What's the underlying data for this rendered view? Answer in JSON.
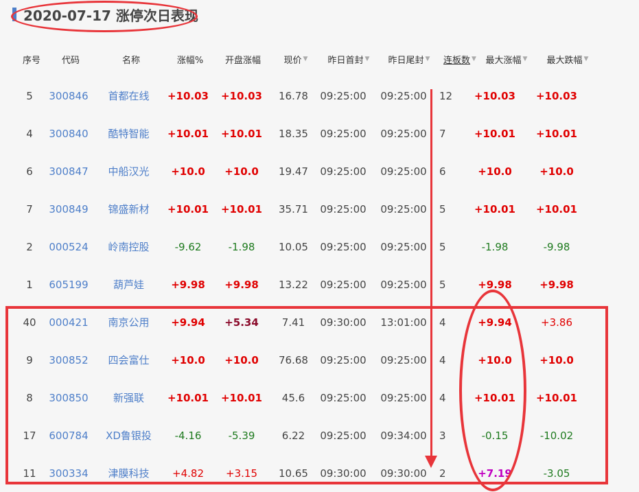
{
  "title": "2020-07-17 涨停次日表现",
  "headers": [
    {
      "label": "序号",
      "arrow": "",
      "underline": false
    },
    {
      "label": "代码",
      "arrow": "",
      "underline": false
    },
    {
      "label": "名称",
      "arrow": "",
      "underline": false
    },
    {
      "label": "涨幅%",
      "arrow": "",
      "underline": false
    },
    {
      "label": "开盘涨幅",
      "arrow": "",
      "underline": false
    },
    {
      "label": "现价",
      "arrow": "▼",
      "underline": false
    },
    {
      "label": "昨日首封",
      "arrow": "▼",
      "underline": false
    },
    {
      "label": "昨日尾封",
      "arrow": "▼",
      "underline": false
    },
    {
      "label": "连板数",
      "arrow": "▼",
      "underline": true
    },
    {
      "label": "最大涨幅",
      "arrow": "▼",
      "underline": false
    },
    {
      "label": "最大跌幅",
      "arrow": "▼",
      "underline": false
    }
  ],
  "rows": [
    {
      "idx": "5",
      "code": "300846",
      "name": "首都在线",
      "chg": "+10.03",
      "open": "+10.03",
      "price": "16.78",
      "first": "09:25:00",
      "last": "09:25:00",
      "boards": "12",
      "maxup": "+10.03",
      "maxdown": "+10.03",
      "s": {
        "chg": "redb",
        "open": "redb",
        "maxup": "redb",
        "maxdown": "redb"
      }
    },
    {
      "idx": "4",
      "code": "300840",
      "name": "酷特智能",
      "chg": "+10.01",
      "open": "+10.01",
      "price": "18.35",
      "first": "09:25:00",
      "last": "09:25:00",
      "boards": "7",
      "maxup": "+10.01",
      "maxdown": "+10.01",
      "s": {
        "chg": "redb",
        "open": "redb",
        "maxup": "redb",
        "maxdown": "redb"
      }
    },
    {
      "idx": "6",
      "code": "300847",
      "name": "中船汉光",
      "chg": "+10.0",
      "open": "+10.0",
      "price": "19.47",
      "first": "09:25:00",
      "last": "09:25:00",
      "boards": "6",
      "maxup": "+10.0",
      "maxdown": "+10.0",
      "s": {
        "chg": "redb",
        "open": "redb",
        "maxup": "redb",
        "maxdown": "redb"
      }
    },
    {
      "idx": "7",
      "code": "300849",
      "name": "锦盛新材",
      "chg": "+10.01",
      "open": "+10.01",
      "price": "35.71",
      "first": "09:25:00",
      "last": "09:25:00",
      "boards": "5",
      "maxup": "+10.01",
      "maxdown": "+10.01",
      "s": {
        "chg": "redb",
        "open": "redb",
        "maxup": "redb",
        "maxdown": "redb"
      }
    },
    {
      "idx": "2",
      "code": "000524",
      "name": "岭南控股",
      "chg": "-9.62",
      "open": "-1.98",
      "price": "10.05",
      "first": "09:25:00",
      "last": "09:25:00",
      "boards": "5",
      "maxup": "-1.98",
      "maxdown": "-9.98",
      "s": {
        "chg": "green",
        "open": "green",
        "maxup": "green",
        "maxdown": "green"
      }
    },
    {
      "idx": "1",
      "code": "605199",
      "name": "葫芦娃",
      "chg": "+9.98",
      "open": "+9.98",
      "price": "13.22",
      "first": "09:25:00",
      "last": "09:25:00",
      "boards": "5",
      "maxup": "+9.98",
      "maxdown": "+9.98",
      "s": {
        "chg": "redb",
        "open": "redb",
        "maxup": "redb",
        "maxdown": "redb"
      }
    },
    {
      "idx": "40",
      "code": "000421",
      "name": "南京公用",
      "chg": "+9.94",
      "open": "+5.34",
      "price": "7.41",
      "first": "09:30:00",
      "last": "13:01:00",
      "boards": "4",
      "maxup": "+9.94",
      "maxdown": "+3.86",
      "s": {
        "chg": "redb",
        "open": "maroon",
        "maxup": "redb",
        "maxdown": "red"
      }
    },
    {
      "idx": "9",
      "code": "300852",
      "name": "四会富仕",
      "chg": "+10.0",
      "open": "+10.0",
      "price": "76.68",
      "first": "09:25:00",
      "last": "09:25:00",
      "boards": "4",
      "maxup": "+10.0",
      "maxdown": "+10.0",
      "s": {
        "chg": "redb",
        "open": "redb",
        "maxup": "redb",
        "maxdown": "redb"
      }
    },
    {
      "idx": "8",
      "code": "300850",
      "name": "新强联",
      "chg": "+10.01",
      "open": "+10.01",
      "price": "45.6",
      "first": "09:25:00",
      "last": "09:25:00",
      "boards": "4",
      "maxup": "+10.01",
      "maxdown": "+10.01",
      "s": {
        "chg": "redb",
        "open": "redb",
        "maxup": "redb",
        "maxdown": "redb"
      }
    },
    {
      "idx": "17",
      "code": "600784",
      "name": "XD鲁银投",
      "chg": "-4.16",
      "open": "-5.39",
      "price": "6.22",
      "first": "09:25:00",
      "last": "09:34:00",
      "boards": "3",
      "maxup": "-0.15",
      "maxdown": "-10.02",
      "s": {
        "chg": "green",
        "open": "green",
        "maxup": "green",
        "maxdown": "green"
      }
    },
    {
      "idx": "11",
      "code": "300334",
      "name": "津膜科技",
      "chg": "+4.82",
      "open": "+3.15",
      "price": "10.65",
      "first": "09:30:00",
      "last": "09:30:00",
      "boards": "2",
      "maxup": "+7.19",
      "maxdown": "-3.05",
      "s": {
        "chg": "red",
        "open": "red",
        "maxup": "purple",
        "maxdown": "green"
      }
    }
  ]
}
